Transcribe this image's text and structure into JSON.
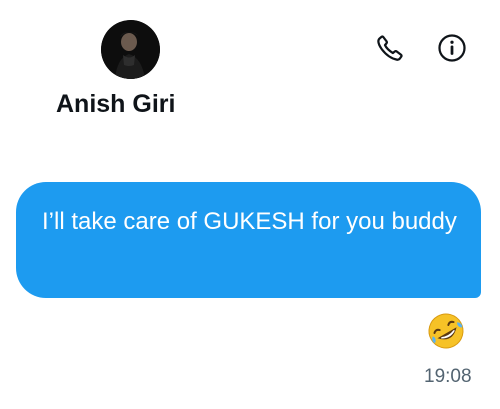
{
  "header": {
    "contact_name": "Anish Giri",
    "avatar_icon": "avatar-photo",
    "call_icon": "phone-icon",
    "info_icon": "info-icon"
  },
  "messages": [
    {
      "text": "I’ll take care of GUKESH for you buddy",
      "direction": "outgoing",
      "reaction_icon": "rolling-on-floor-laughing-emoji",
      "time": "19:08"
    }
  ],
  "colors": {
    "bubble": "#1d9bf0",
    "bubble_text": "#ffffff",
    "name_text": "#0f1419",
    "timestamp_text": "#536471",
    "emoji_face": "#f6c227"
  }
}
